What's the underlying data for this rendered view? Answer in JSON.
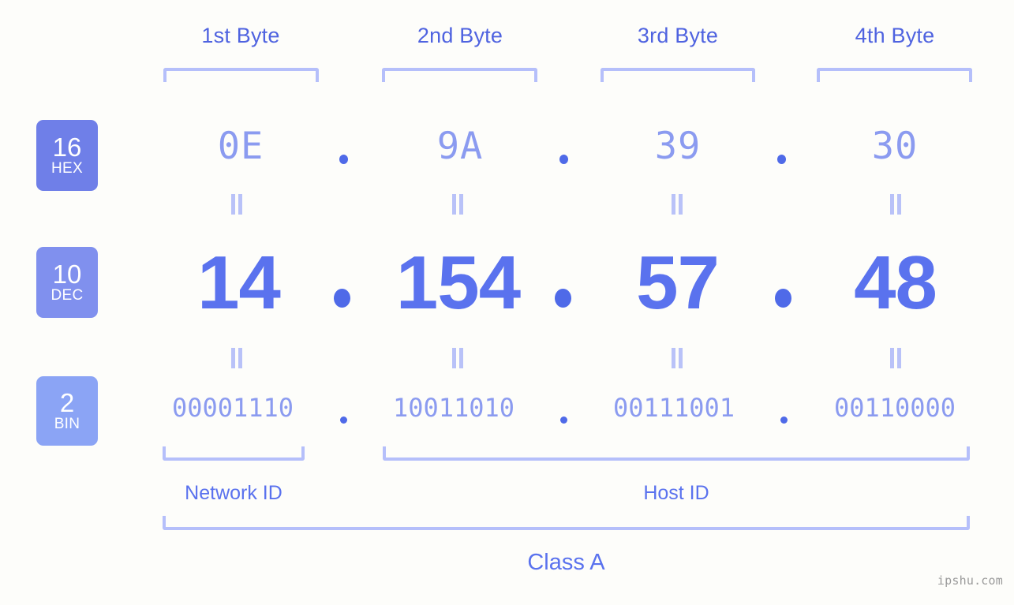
{
  "diagram": {
    "title": "IP Address Byte Breakdown",
    "background_color": "#fdfdfa",
    "accent_color": "#5a72ee",
    "bracket_color": "#b5bffa"
  },
  "byte_headers": [
    {
      "label": "1st Byte"
    },
    {
      "label": "2nd Byte"
    },
    {
      "label": "3rd Byte"
    },
    {
      "label": "4th Byte"
    }
  ],
  "bases": [
    {
      "number": "16",
      "name": "HEX",
      "color": "#6f7fe8"
    },
    {
      "number": "10",
      "name": "DEC",
      "color": "#8090ee"
    },
    {
      "number": "2",
      "name": "BIN",
      "color": "#8ba4f5"
    }
  ],
  "rows": {
    "hex": {
      "values": [
        "0E",
        "9A",
        "39",
        "30"
      ],
      "separator": "."
    },
    "dec": {
      "values": [
        "14",
        "154",
        "57",
        "48"
      ],
      "separator": "."
    },
    "bin": {
      "values": [
        "00001110",
        "10011010",
        "00111001",
        "00110000"
      ],
      "separator": "."
    }
  },
  "equals_symbol": "=",
  "sections": [
    {
      "label": "Network ID"
    },
    {
      "label": "Host ID"
    }
  ],
  "class": {
    "label": "Class A"
  },
  "watermark": {
    "text": "ipshu.com"
  },
  "chart_data": {
    "type": "table",
    "title": "IP Address 14.154.57.48 byte representation",
    "columns": [
      "1st Byte",
      "2nd Byte",
      "3rd Byte",
      "4th Byte"
    ],
    "rows": [
      {
        "base": "16 HEX",
        "values": [
          "0E",
          "9A",
          "39",
          "30"
        ]
      },
      {
        "base": "10 DEC",
        "values": [
          "14",
          "154",
          "57",
          "48"
        ]
      },
      {
        "base": "2 BIN",
        "values": [
          "00001110",
          "10011010",
          "00111001",
          "00110000"
        ]
      }
    ],
    "network_id_bytes": [
      1
    ],
    "host_id_bytes": [
      2,
      3,
      4
    ],
    "ip_class": "Class A"
  }
}
